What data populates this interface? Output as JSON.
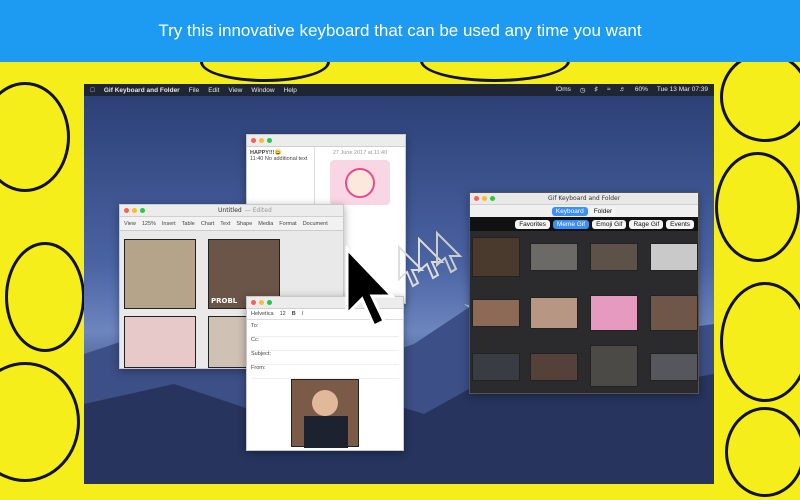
{
  "banner": {
    "text": "Try this innovative keyboard that can be used any time you want"
  },
  "menubar": {
    "apple_icon": "apple-icon",
    "app_name": "Gif Keyboard and Folder",
    "menus": [
      "File",
      "Edit",
      "View",
      "Window",
      "Help"
    ],
    "status": {
      "ioms": "IOms",
      "battery": "60%",
      "datetime": "Tue 13 Mar  07:39"
    }
  },
  "messages_window": {
    "contact": "HAPPY!!!😀",
    "preview": "11:40  No additional text",
    "timestamp": "27 June 2017 at 11:40"
  },
  "pages_window": {
    "title": "Untitled",
    "subtitle": "— Edited",
    "zoom": "125%",
    "toolbar": [
      "View",
      "Zoom",
      "Insert",
      "Table",
      "Chart",
      "Text",
      "Shape",
      "Media",
      "Format",
      "Document"
    ],
    "meme_caption": "PROBL"
  },
  "mail_window": {
    "font": "Helvetica",
    "font_size": "12",
    "fields": [
      "To:",
      "Cc:",
      "Subject:",
      "From:"
    ]
  },
  "gif_window": {
    "title": "Gif Keyboard and Folder",
    "tabs": [
      "Keyboard",
      "Folder"
    ],
    "active_tab": "Keyboard",
    "categories": [
      "Favorites",
      "Meme Gif",
      "Emoji Gif",
      "Rage Gif",
      "Events"
    ],
    "active_category": "Meme Gif"
  },
  "colors": {
    "banner": "#1d9bf2",
    "yellow": "#f6ee1a",
    "accent": "#3b8ff6"
  }
}
